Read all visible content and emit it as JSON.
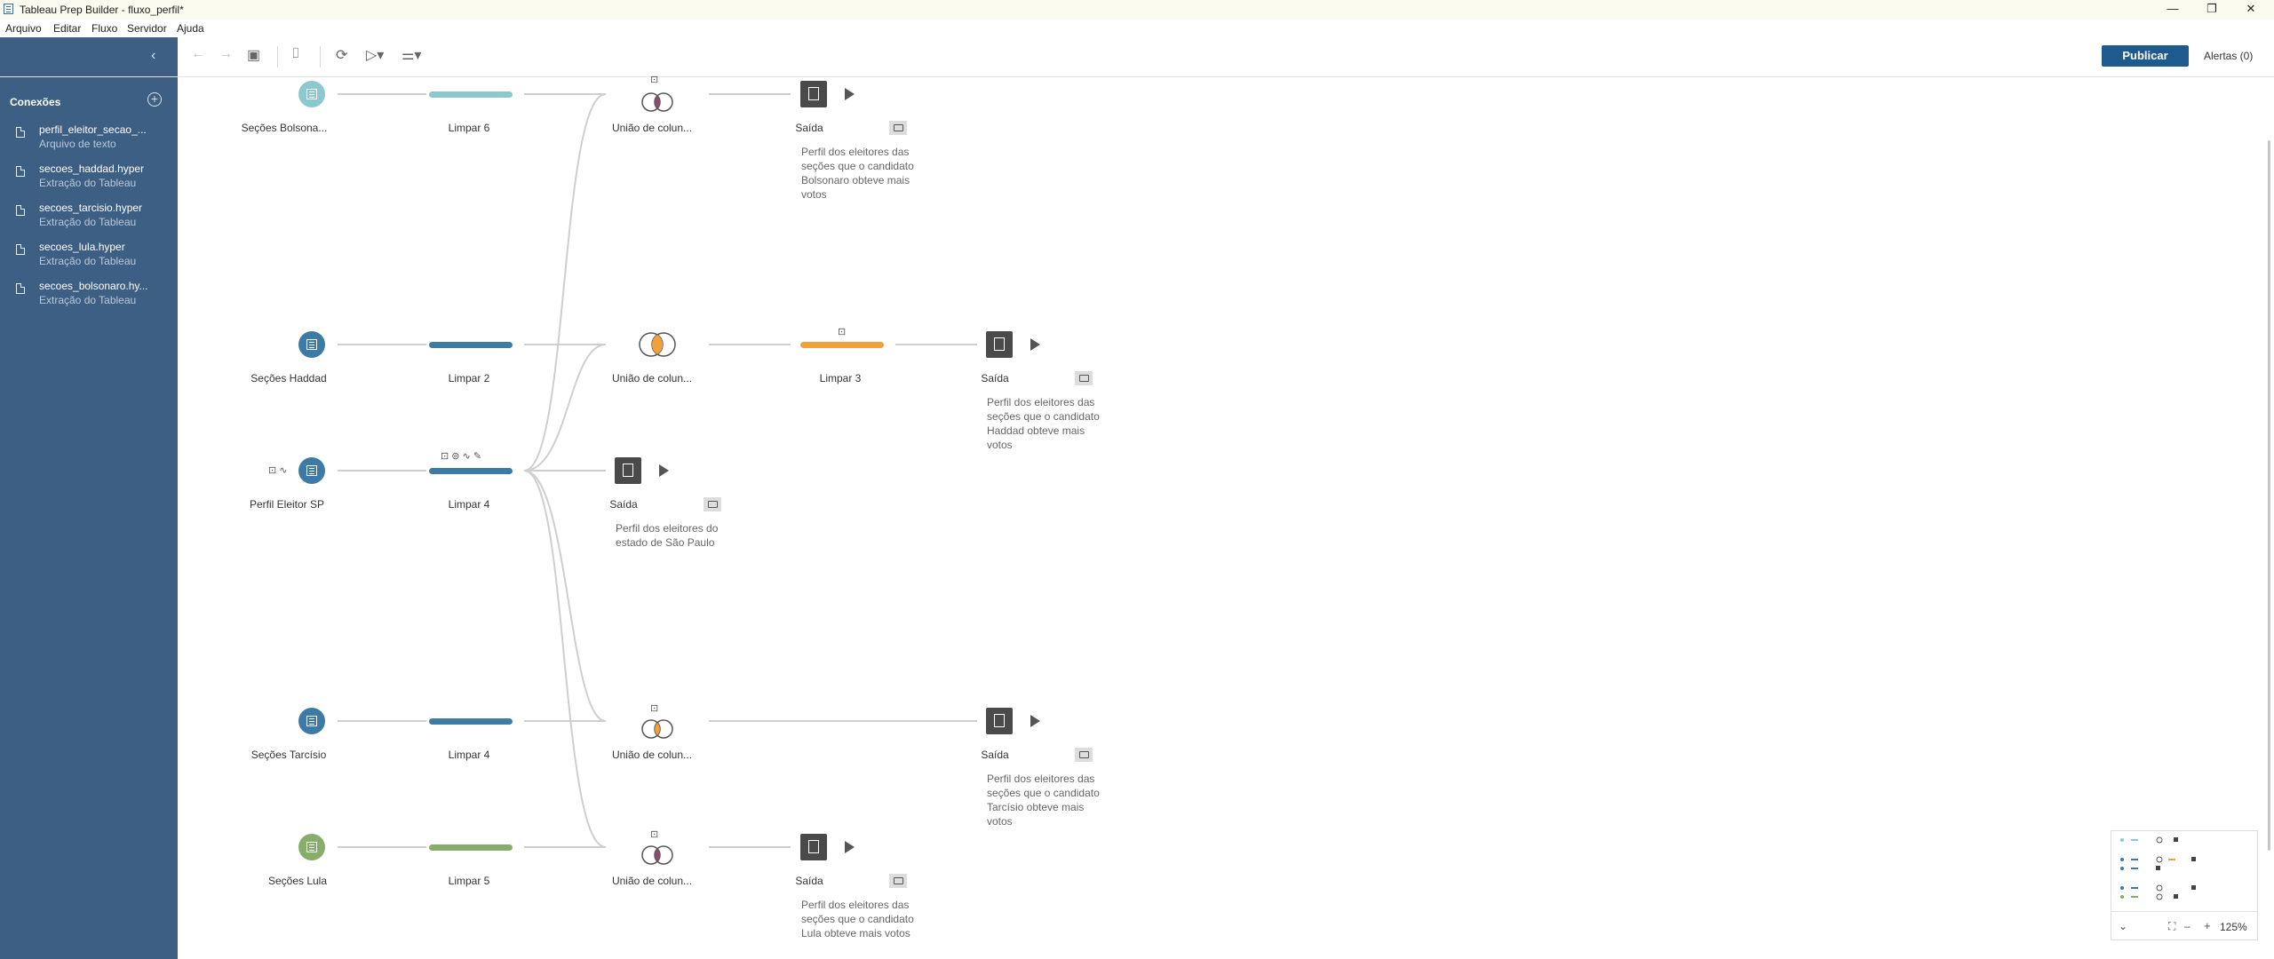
{
  "window": {
    "title": "Tableau Prep Builder - fluxo_perfil*",
    "minimize": "—",
    "restore": "❐",
    "close": "✕"
  },
  "menu": [
    "Arquivo",
    "Editar",
    "Fluxo",
    "Servidor",
    "Ajuda"
  ],
  "toolbar": {
    "publish_label": "Publicar",
    "alerts_label": "Alertas (0)"
  },
  "sidebar": {
    "header": "Conexões",
    "connections": [
      {
        "name": "perfil_eleitor_secao_...",
        "type": "Arquivo de texto"
      },
      {
        "name": "secoes_haddad.hyper",
        "type": "Extração do Tableau"
      },
      {
        "name": "secoes_tarcisio.hyper",
        "type": "Extração do Tableau"
      },
      {
        "name": "secoes_lula.hyper",
        "type": "Extração do Tableau"
      },
      {
        "name": "secoes_bolsonaro.hy...",
        "type": "Extração do Tableau"
      }
    ]
  },
  "flow": {
    "inputs": [
      {
        "label": "Seções Bolsona...",
        "color": "#8ec8cf"
      },
      {
        "label": "Seções Haddad",
        "color": "#3e7aa6"
      },
      {
        "label": "Perfil Eleitor SP",
        "color": "#3e7aa6"
      },
      {
        "label": "Seções Tarcísio",
        "color": "#3e7aa6"
      },
      {
        "label": "Seções Lula",
        "color": "#86ad6a"
      }
    ],
    "cleans": [
      {
        "label": "Limpar 6",
        "color": "#8ec8cf"
      },
      {
        "label": "Limpar 2",
        "color": "#3e7aa6"
      },
      {
        "label": "Limpar 4",
        "color": "#3e7aa6"
      },
      {
        "label": "Limpar 4",
        "color": "#3e7aa6"
      },
      {
        "label": "Limpar 5",
        "color": "#86ad6a"
      }
    ],
    "joins": [
      {
        "label": "União de colun..."
      },
      {
        "label": "União de colun..."
      },
      {
        "label": "União de colun..."
      },
      {
        "label": "União de colun..."
      }
    ],
    "clean3": {
      "label": "Limpar 3",
      "color": "#f2a03d"
    },
    "outputs": [
      {
        "label": "Saída",
        "description": "Perfil dos eleitores das seções que o candidato Bolsonaro obteve mais votos"
      },
      {
        "label": "Saída",
        "description": "Perfil dos eleitores das seções que o candidato Haddad obteve mais votos"
      },
      {
        "label": "Saída",
        "description": "Perfil dos eleitores do estado de São Paulo"
      },
      {
        "label": "Saída",
        "description": "Perfil dos eleitores das seções que o candidato Tarcísio obteve mais votos"
      },
      {
        "label": "Saída",
        "description": "Perfil dos eleitores das seções que o candidato Lula obteve mais votos"
      }
    ]
  },
  "zoom": {
    "level": "125%",
    "minus": "–",
    "plus": "+"
  }
}
